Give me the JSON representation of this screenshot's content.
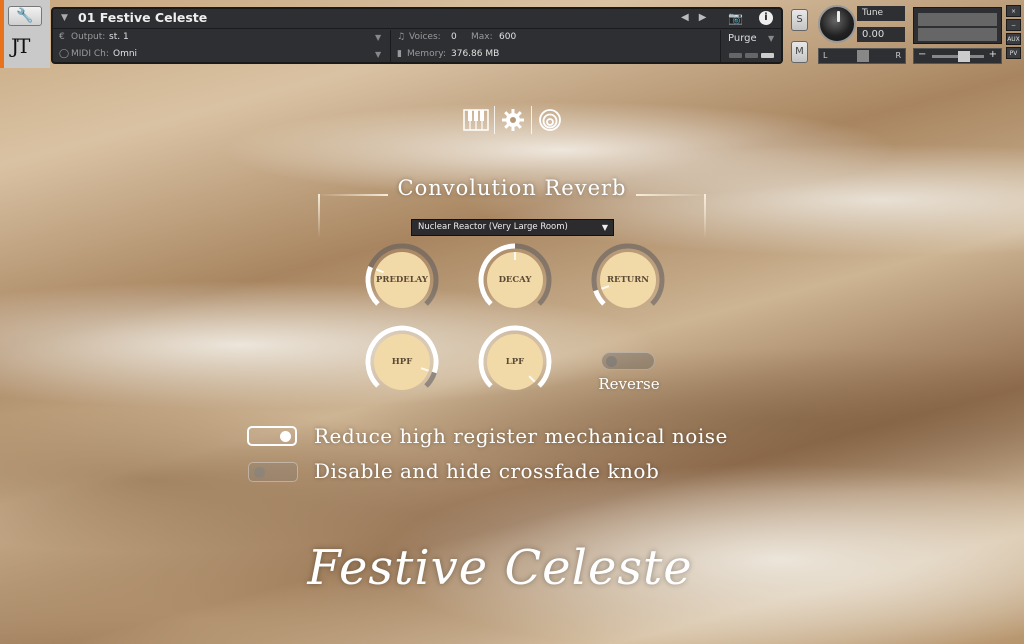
{
  "header": {
    "logo": "JT",
    "instrument_name": "01 Festive Celeste",
    "output_label": "Output:",
    "output_value": "st. 1",
    "midi_label": "MIDI Ch:",
    "midi_value": "Omni",
    "voices_label": "Voices:",
    "voices_value": "0",
    "max_label": "Max:",
    "max_value": "600",
    "memory_label": "Memory:",
    "memory_value": "376.86 MB",
    "purge_label": "Purge",
    "solo_label": "S",
    "mute_label": "M",
    "tune_label": "Tune",
    "tune_value": "0.00",
    "pan_left": "L",
    "pan_right": "R",
    "vol_minus": "−",
    "vol_plus": "+",
    "side_buttons": [
      "×",
      "−",
      "AUX",
      "PV"
    ]
  },
  "tabs": [
    "piano-icon",
    "gear-icon",
    "reverb-icon"
  ],
  "reverb": {
    "title": "Convolution Reverb",
    "preset": "Nuclear Reactor (Very Large Room)",
    "knobs": {
      "predelay": {
        "label": "PREDELAY",
        "value": 0.25
      },
      "decay": {
        "label": "DECAY",
        "value": 0.5
      },
      "return": {
        "label": "RETURN",
        "value": 0.1
      },
      "hpf": {
        "label": "HPF",
        "value": 0.9
      },
      "lpf": {
        "label": "LPF",
        "value": 1.0
      }
    },
    "reverse_label": "Reverse",
    "reverse_on": false
  },
  "options": {
    "reduce_noise_label": "Reduce high register mechanical noise",
    "reduce_noise_on": true,
    "disable_crossfade_label": "Disable and hide crossfade knob",
    "disable_crossfade_on": false
  },
  "brand": "Festive Celeste",
  "colors": {
    "accent_orange": "#e8731c",
    "knob_face": "#f2d9a8",
    "panel_dark": "#2d2f33"
  }
}
